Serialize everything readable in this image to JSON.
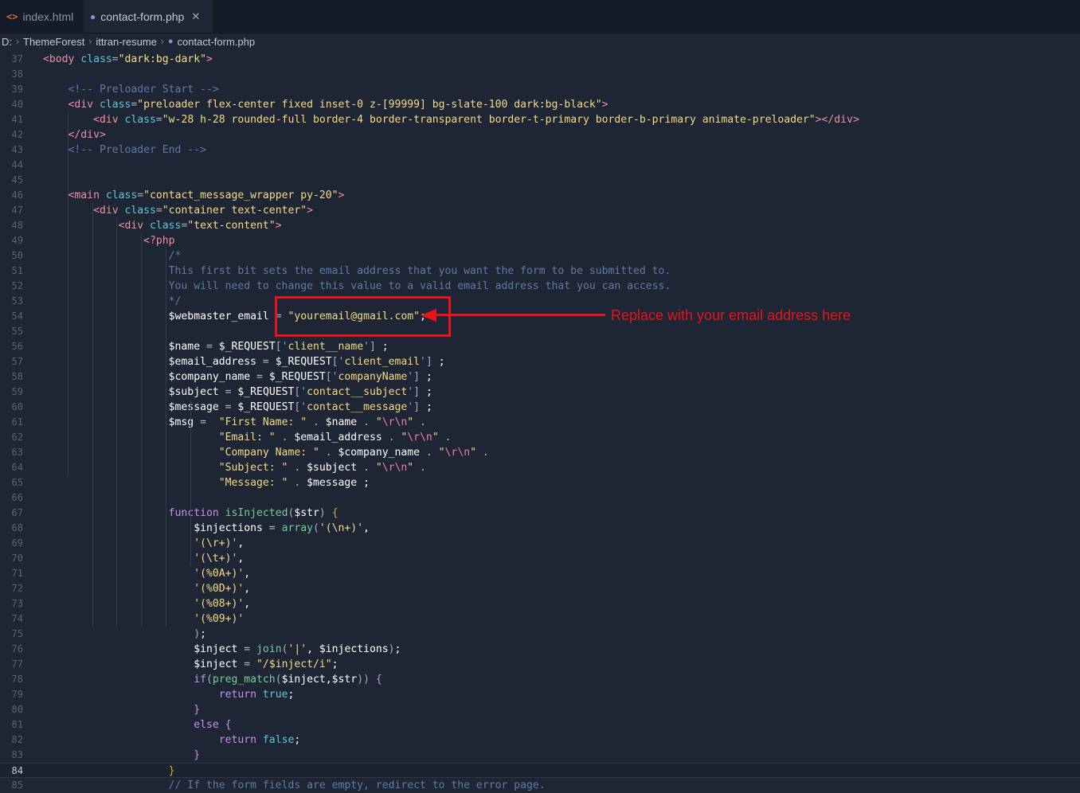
{
  "tabs": [
    {
      "icon": "<>",
      "label": "index.html",
      "active": false
    },
    {
      "icon": "php-elephant-icon",
      "label": "contact-form.php",
      "active": true,
      "close": "✕"
    }
  ],
  "breadcrumb": [
    "D:",
    "ThemeForest",
    "ittran-resume",
    "contact-form.php"
  ],
  "current_line": 84,
  "annotation": {
    "text": "Replace with your email address here",
    "color": "#e8141a"
  },
  "colors": {
    "background": "#1e2635",
    "tag": "#f08fa7",
    "attribute": "#62c5d9",
    "string": "#f5dc84",
    "comment": "#5f7ba6",
    "keyword": "#c792ea",
    "function": "#79cc9b"
  },
  "lines": [
    {
      "n": "37",
      "segs": [
        [
          "tag",
          "<body "
        ],
        [
          "attr",
          "class"
        ],
        [
          "punc",
          "="
        ],
        [
          "str",
          "\"dark:bg-dark\""
        ],
        [
          "tag",
          ">"
        ]
      ]
    },
    {
      "n": "38",
      "segs": []
    },
    {
      "n": "39",
      "segs": [
        [
          "cmt",
          "    <!-- Preloader Start -->"
        ]
      ]
    },
    {
      "n": "40",
      "segs": [
        [
          "tag",
          "    <div "
        ],
        [
          "attr",
          "class"
        ],
        [
          "punc",
          "="
        ],
        [
          "str",
          "\"preloader flex-center fixed inset-0 z-[99999] bg-slate-100 dark:bg-black\""
        ],
        [
          "tag",
          ">"
        ]
      ]
    },
    {
      "n": "41",
      "segs": [
        [
          "tag",
          "        <div "
        ],
        [
          "attr",
          "class"
        ],
        [
          "punc",
          "="
        ],
        [
          "str",
          "\"w-28 h-28 rounded-full border-4 border-transparent border-t-primary border-b-primary animate-preloader\""
        ],
        [
          "tag",
          "></div>"
        ]
      ]
    },
    {
      "n": "42",
      "segs": [
        [
          "tag",
          "    </div>"
        ]
      ]
    },
    {
      "n": "43",
      "segs": [
        [
          "cmt",
          "    <!-- Preloader End -->"
        ]
      ]
    },
    {
      "n": "44",
      "segs": []
    },
    {
      "n": "45",
      "segs": []
    },
    {
      "n": "46",
      "segs": [
        [
          "tag",
          "    <main "
        ],
        [
          "attr",
          "class"
        ],
        [
          "punc",
          "="
        ],
        [
          "str",
          "\"contact_message_wrapper py-20\""
        ],
        [
          "tag",
          ">"
        ]
      ]
    },
    {
      "n": "47",
      "segs": [
        [
          "tag",
          "        <div "
        ],
        [
          "attr",
          "class"
        ],
        [
          "punc",
          "="
        ],
        [
          "str",
          "\"container text-center\""
        ],
        [
          "tag",
          ">"
        ]
      ]
    },
    {
      "n": "48",
      "segs": [
        [
          "tag",
          "            <div "
        ],
        [
          "attr",
          "class"
        ],
        [
          "punc",
          "="
        ],
        [
          "str",
          "\"text-content\""
        ],
        [
          "tag",
          ">"
        ]
      ]
    },
    {
      "n": "49",
      "segs": [
        [
          "tag",
          "                <?php"
        ]
      ]
    },
    {
      "n": "50",
      "segs": [
        [
          "cmt",
          "                    /*"
        ]
      ]
    },
    {
      "n": "51",
      "segs": [
        [
          "cmt",
          "                    This first bit sets the email address that you want the form to be submitted to."
        ]
      ]
    },
    {
      "n": "52",
      "segs": [
        [
          "cmt",
          "                    You will need to change this value to a valid email address that you can access."
        ]
      ]
    },
    {
      "n": "53",
      "segs": [
        [
          "cmt",
          "                    */"
        ]
      ]
    },
    {
      "n": "54",
      "segs": [
        [
          "var",
          "                    $webmaster_email "
        ],
        [
          "op",
          "= "
        ],
        [
          "str",
          "\"youremail@gmail.com\""
        ],
        [
          "var",
          ";"
        ]
      ]
    },
    {
      "n": "55",
      "segs": []
    },
    {
      "n": "56",
      "segs": [
        [
          "var",
          "                    $name "
        ],
        [
          "op",
          "= "
        ],
        [
          "var",
          "$_REQUEST"
        ],
        [
          "punc",
          "["
        ],
        [
          "sq",
          "'"
        ],
        [
          "str",
          "client__name"
        ],
        [
          "sq",
          "'"
        ],
        [
          "punc",
          "]"
        ],
        [
          "var",
          " ;"
        ]
      ]
    },
    {
      "n": "57",
      "segs": [
        [
          "var",
          "                    $email_address "
        ],
        [
          "op",
          "= "
        ],
        [
          "var",
          "$_REQUEST"
        ],
        [
          "punc",
          "["
        ],
        [
          "sq",
          "'"
        ],
        [
          "str",
          "client_email"
        ],
        [
          "sq",
          "'"
        ],
        [
          "punc",
          "]"
        ],
        [
          "var",
          " ;"
        ]
      ]
    },
    {
      "n": "58",
      "segs": [
        [
          "var",
          "                    $company_name "
        ],
        [
          "op",
          "= "
        ],
        [
          "var",
          "$_REQUEST"
        ],
        [
          "punc",
          "["
        ],
        [
          "sq",
          "'"
        ],
        [
          "str",
          "companyName"
        ],
        [
          "sq",
          "'"
        ],
        [
          "punc",
          "]"
        ],
        [
          "var",
          " ;"
        ]
      ]
    },
    {
      "n": "59",
      "segs": [
        [
          "var",
          "                    $subject "
        ],
        [
          "op",
          "= "
        ],
        [
          "var",
          "$_REQUEST"
        ],
        [
          "punc",
          "["
        ],
        [
          "sq",
          "'"
        ],
        [
          "str",
          "contact__subject"
        ],
        [
          "sq",
          "'"
        ],
        [
          "punc",
          "]"
        ],
        [
          "var",
          " ;"
        ]
      ]
    },
    {
      "n": "60",
      "segs": [
        [
          "var",
          "                    $message "
        ],
        [
          "op",
          "= "
        ],
        [
          "var",
          "$_REQUEST"
        ],
        [
          "punc",
          "["
        ],
        [
          "sq",
          "'"
        ],
        [
          "str",
          "contact__message"
        ],
        [
          "sq",
          "'"
        ],
        [
          "punc",
          "]"
        ],
        [
          "var",
          " ;"
        ]
      ]
    },
    {
      "n": "61",
      "segs": [
        [
          "var",
          "                    $msg "
        ],
        [
          "op",
          "=  "
        ],
        [
          "str",
          "\"First Name: \""
        ],
        [
          "op",
          " . "
        ],
        [
          "var",
          "$name"
        ],
        [
          "op",
          " . "
        ],
        [
          "str",
          "\""
        ],
        [
          "esc",
          "\\r\\n"
        ],
        [
          "str",
          "\""
        ],
        [
          "op",
          " ."
        ]
      ]
    },
    {
      "n": "62",
      "segs": [
        [
          "str",
          "                            \"Email: \""
        ],
        [
          "op",
          " . "
        ],
        [
          "var",
          "$email_address"
        ],
        [
          "op",
          " . "
        ],
        [
          "str",
          "\""
        ],
        [
          "esc",
          "\\r\\n"
        ],
        [
          "str",
          "\""
        ],
        [
          "op",
          " ."
        ]
      ]
    },
    {
      "n": "63",
      "segs": [
        [
          "str",
          "                            \"Company Name: \""
        ],
        [
          "op",
          " . "
        ],
        [
          "var",
          "$company_name"
        ],
        [
          "op",
          " . "
        ],
        [
          "str",
          "\""
        ],
        [
          "esc",
          "\\r\\n"
        ],
        [
          "str",
          "\""
        ],
        [
          "op",
          " ."
        ]
      ]
    },
    {
      "n": "64",
      "segs": [
        [
          "str",
          "                            \"Subject: \""
        ],
        [
          "op",
          " . "
        ],
        [
          "var",
          "$subject"
        ],
        [
          "op",
          " . "
        ],
        [
          "str",
          "\""
        ],
        [
          "esc",
          "\\r\\n"
        ],
        [
          "str",
          "\""
        ],
        [
          "op",
          " ."
        ]
      ]
    },
    {
      "n": "65",
      "segs": [
        [
          "str",
          "                            \"Message: \""
        ],
        [
          "op",
          " . "
        ],
        [
          "var",
          "$message"
        ],
        [
          "var",
          " ;"
        ]
      ]
    },
    {
      "n": "66",
      "segs": []
    },
    {
      "n": "67",
      "segs": [
        [
          "kw",
          "                    function "
        ],
        [
          "fn",
          "isInjected"
        ],
        [
          "punc",
          "("
        ],
        [
          "var",
          "$str"
        ],
        [
          "punc",
          ") "
        ],
        [
          "brace",
          "{"
        ]
      ]
    },
    {
      "n": "68",
      "segs": [
        [
          "var",
          "                        $injections "
        ],
        [
          "op",
          "= "
        ],
        [
          "fn",
          "array"
        ],
        [
          "punc",
          "("
        ],
        [
          "str",
          "'(\\n+)'"
        ],
        [
          "var",
          ","
        ]
      ]
    },
    {
      "n": "69",
      "segs": [
        [
          "str",
          "                        '(\\r+)'"
        ],
        [
          "var",
          ","
        ]
      ]
    },
    {
      "n": "70",
      "segs": [
        [
          "str",
          "                        '(\\t+)'"
        ],
        [
          "var",
          ","
        ]
      ]
    },
    {
      "n": "71",
      "segs": [
        [
          "str",
          "                        '(%0A+)'"
        ],
        [
          "var",
          ","
        ]
      ]
    },
    {
      "n": "72",
      "segs": [
        [
          "str",
          "                        '(%0D+)'"
        ],
        [
          "var",
          ","
        ]
      ]
    },
    {
      "n": "73",
      "segs": [
        [
          "str",
          "                        '(%08+)'"
        ],
        [
          "var",
          ","
        ]
      ]
    },
    {
      "n": "74",
      "segs": [
        [
          "str",
          "                        '(%09+)'"
        ]
      ]
    },
    {
      "n": "75",
      "segs": [
        [
          "punc",
          "                        )"
        ],
        [
          "var",
          ";"
        ]
      ]
    },
    {
      "n": "76",
      "segs": [
        [
          "var",
          "                        $inject "
        ],
        [
          "op",
          "= "
        ],
        [
          "fn",
          "join"
        ],
        [
          "punc",
          "("
        ],
        [
          "str",
          "'|'"
        ],
        [
          "var",
          ", $injections"
        ],
        [
          "punc",
          ")"
        ],
        [
          "var",
          ";"
        ]
      ]
    },
    {
      "n": "77",
      "segs": [
        [
          "var",
          "                        $inject "
        ],
        [
          "op",
          "= "
        ],
        [
          "str",
          "\"/$inject/i\""
        ],
        [
          "var",
          ";"
        ]
      ]
    },
    {
      "n": "78",
      "segs": [
        [
          "kw",
          "                        if"
        ],
        [
          "punc",
          "("
        ],
        [
          "fn",
          "preg_match"
        ],
        [
          "punc",
          "("
        ],
        [
          "var",
          "$inject,$str"
        ],
        [
          "punc",
          "))"
        ],
        [
          "kw",
          " {"
        ]
      ]
    },
    {
      "n": "79",
      "segs": [
        [
          "kw",
          "                            return "
        ],
        [
          "attr",
          "true"
        ],
        [
          "var",
          ";"
        ]
      ]
    },
    {
      "n": "80",
      "segs": [
        [
          "kw",
          "                        }"
        ]
      ]
    },
    {
      "n": "81",
      "segs": [
        [
          "kw",
          "                        else {"
        ]
      ]
    },
    {
      "n": "82",
      "segs": [
        [
          "kw",
          "                            return "
        ],
        [
          "attr",
          "false"
        ],
        [
          "var",
          ";"
        ]
      ]
    },
    {
      "n": "83",
      "segs": [
        [
          "kw",
          "                        }"
        ]
      ]
    },
    {
      "n": "84",
      "segs": [
        [
          "brace",
          "                    }"
        ]
      ]
    },
    {
      "n": "85",
      "segs": [
        [
          "cmt",
          "                    // If the form fields are empty, redirect to the error page."
        ]
      ]
    }
  ]
}
